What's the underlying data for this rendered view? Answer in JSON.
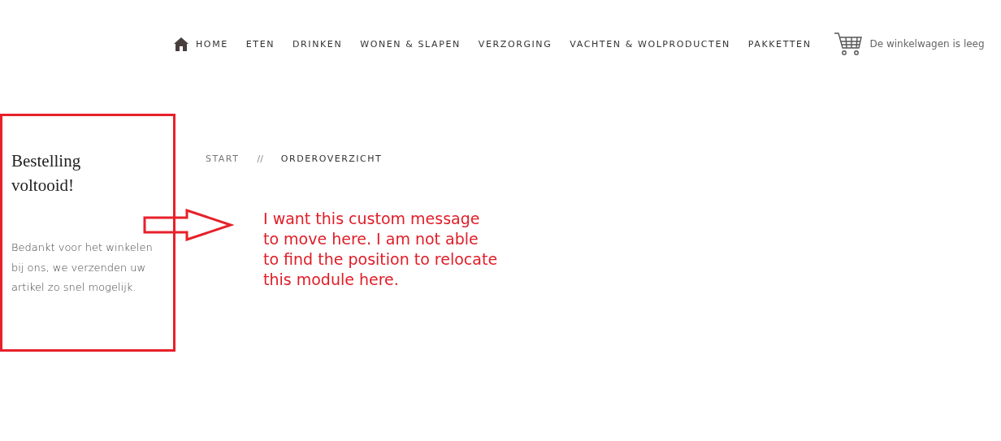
{
  "nav": {
    "items": [
      {
        "label": "HOME",
        "kind": "home"
      },
      {
        "label": "ETEN",
        "kind": "plain"
      },
      {
        "label": "DRINKEN",
        "kind": "plain"
      },
      {
        "label": "WONEN & SLAPEN",
        "kind": "plain"
      },
      {
        "label": "VERZORGING",
        "kind": "plain"
      },
      {
        "label": "VACHTEN & WOLPRODUCTEN",
        "kind": "plain"
      },
      {
        "label": "PAKKETTEN",
        "kind": "plain"
      }
    ],
    "cart": "De winkelwagen is leeg"
  },
  "sidebar": {
    "title": "Bestelling voltooid!",
    "text": "Bedankt voor het winkelen bij ons, we verzenden uw artikel zo snel mogelijk."
  },
  "breadcrumb": {
    "items": [
      "START",
      "ORDEROVERZICHT"
    ],
    "separator": "//"
  },
  "annotation": {
    "lines": [
      "I want this custom message",
      "to move here. I am not able",
      "to find the position to relocate",
      "this module here."
    ]
  }
}
